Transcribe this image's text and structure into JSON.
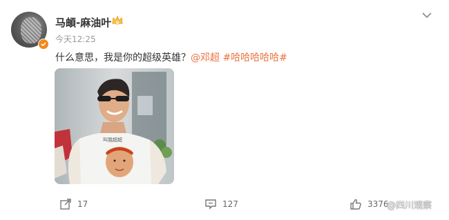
{
  "post": {
    "username": "马頔-麻油叶",
    "timestamp": "今天12:25",
    "text_main": "什么意思，我是你的超级英雄？",
    "mention": "@邓超",
    "hashtag": "#哈哈哈哈哈#",
    "photo_shirt_text": "叫我超超"
  },
  "actions": {
    "repost_count": "17",
    "comment_count": "127",
    "like_count": "3376"
  },
  "watermark": "@四川观察",
  "icons": {
    "verified": "verified-badge-icon",
    "crown": "vip-crown-icon",
    "menu": "chevron-down-icon",
    "repost": "repost-icon",
    "comment": "comment-icon",
    "like": "thumbs-up-icon"
  },
  "colors": {
    "link": "#eb7340",
    "verified": "#f08a1c",
    "meta": "#999999"
  }
}
